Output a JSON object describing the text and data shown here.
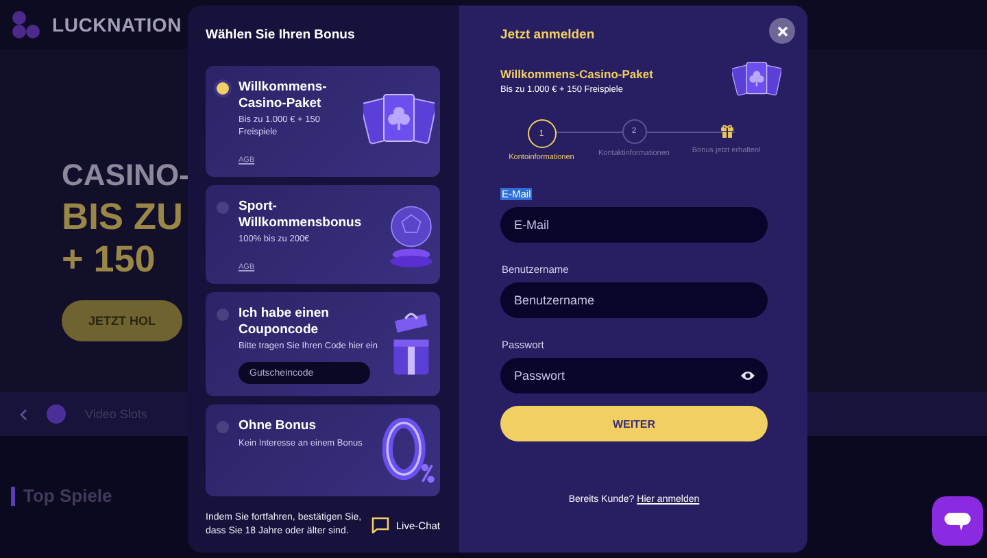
{
  "background": {
    "logo": "LUCKNATION",
    "hero_lines": [
      "CASINO-",
      "BIS ZU",
      "+ 150"
    ],
    "hero_button": "JETZT HOL",
    "category": "Video Slots",
    "section_title": "Top Spiele"
  },
  "bonus_panel": {
    "title": "Wählen Sie Ihren Bonus",
    "options": [
      {
        "kind": "cards",
        "title": "Willkommens-Casino-Paket",
        "description": "Bis zu 1.000 € + 150 Freispiele",
        "link": "AGB",
        "selected": true
      },
      {
        "kind": "ball",
        "title": "Sport-Willkommensbonus",
        "description": "100% bis zu 200€",
        "link": "AGB",
        "selected": false
      },
      {
        "kind": "gift",
        "title": "Ich habe einen Couponcode",
        "description": "Bitte tragen Sie Ihren Code hier ein",
        "placeholder": "Gutscheincode",
        "selected": false
      },
      {
        "kind": "zero",
        "title": "Ohne Bonus",
        "description": "Kein Interesse an einem Bonus",
        "selected": false
      }
    ],
    "disclaimer": "Indem Sie fortfahren, bestätigen Sie, dass Sie 18 Jahre oder älter sind.",
    "chat_label": "Live-Chat"
  },
  "signup": {
    "title": "Jetzt anmelden",
    "package_title": "Willkommens-Casino-Paket",
    "package_subtitle": "Bis zu 1.000 € + 150 Freispiele",
    "steps": [
      {
        "kind": "number",
        "number": "1",
        "label": "Kontoinformationen",
        "selected": true
      },
      {
        "kind": "number",
        "number": "2",
        "label": "Kontaktinformationen",
        "selected": false
      },
      {
        "kind": "gift",
        "label": "Bonus jetzt erhalten!",
        "selected": false
      }
    ],
    "fields": [
      {
        "kind": "text",
        "label": "E-Mail",
        "placeholder": "E-Mail",
        "highlighted": true
      },
      {
        "kind": "text",
        "label": "Benutzername",
        "placeholder": "Benutzername",
        "highlighted": false
      },
      {
        "kind": "password",
        "label": "Passwort",
        "placeholder": "Passwort",
        "highlighted": false
      }
    ],
    "submit": "WEITER",
    "login_prompt": "Bereits Kunde?",
    "login_link": "Hier anmelden"
  }
}
